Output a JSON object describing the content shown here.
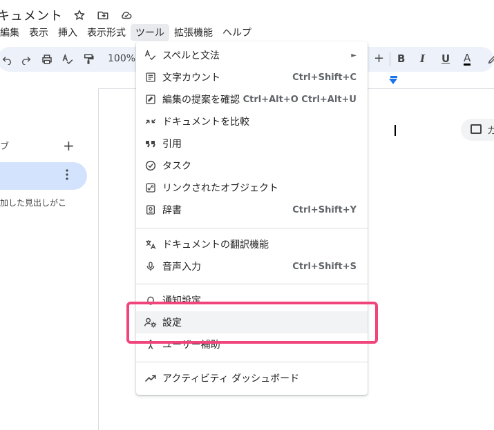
{
  "title": {
    "doc_name": "キュメント"
  },
  "menubar": [
    "編集",
    "表示",
    "挿入",
    "表示形式",
    "ツール",
    "拡張機能",
    "ヘルプ"
  ],
  "toolbar": {
    "zoom": "100%",
    "plus": "+",
    "bold": "B",
    "italic": "I",
    "underline": "U",
    "text_color": "A"
  },
  "side": {
    "tab_label": "ブ",
    "add": "+",
    "hint": "加した見出しがこ"
  },
  "chip": {
    "text": "カ"
  },
  "menu": {
    "items": [
      {
        "label": "スペルと文法",
        "shortcut": "",
        "icon": "spellcheck-icon",
        "has_submenu": true
      },
      {
        "label": "文字カウント",
        "shortcut": "Ctrl+Shift+C",
        "icon": "word-count-icon"
      },
      {
        "label": "編集の提案を確認",
        "shortcut": "Ctrl+Alt+O Ctrl+Alt+U",
        "icon": "review-edits-icon"
      },
      {
        "label": "ドキュメントを比較",
        "shortcut": "",
        "icon": "compare-icon"
      },
      {
        "label": "引用",
        "shortcut": "",
        "icon": "quote-icon"
      },
      {
        "label": "タスク",
        "shortcut": "",
        "icon": "task-icon"
      },
      {
        "label": "リンクされたオブジェクト",
        "shortcut": "",
        "icon": "link-icon"
      },
      {
        "label": "辞書",
        "shortcut": "Ctrl+Shift+Y",
        "icon": "dictionary-icon"
      },
      {
        "label": "ドキュメントの翻訳機能",
        "shortcut": "",
        "icon": "translate-icon"
      },
      {
        "label": "音声入力",
        "shortcut": "Ctrl+Shift+S",
        "icon": "mic-icon"
      },
      {
        "label": "通知設定",
        "shortcut": "",
        "icon": "bell-icon"
      },
      {
        "label": "設定",
        "shortcut": "",
        "icon": "settings-user-icon"
      },
      {
        "label": "ユーザー補助",
        "shortcut": "",
        "icon": "accessibility-icon"
      },
      {
        "label": "アクティビティ ダッシュボード",
        "shortcut": "",
        "icon": "trending-icon"
      }
    ],
    "submenu_arrow": "►"
  },
  "colors": {
    "highlight_border": "#f0457a",
    "toolbar_bg": "#edf2fa",
    "accent": "#1a73e8"
  }
}
